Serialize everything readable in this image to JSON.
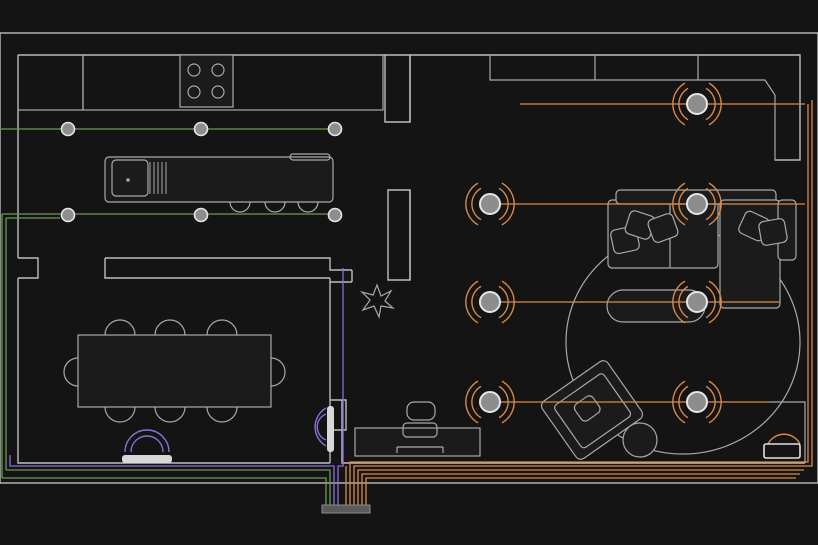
{
  "colors": {
    "background": "#141414",
    "walls": "#bdbdbd",
    "furniture": "#a9a9a9",
    "circuit_green": "#6a9a55",
    "circuit_purple": "#8a6fd6",
    "circuit_orange": "#d98a45",
    "light_ring": "#d98a45",
    "fixture_fill": "#8d8d8d"
  },
  "icons": {
    "hob": "cooktop-icon",
    "sink": "sink-icon",
    "plant": "plant-icon",
    "speaker": "speaker-icon",
    "panel": "distribution-panel-icon"
  },
  "circuits": [
    {
      "id": "kitchen-lighting",
      "color": "circuit_green"
    },
    {
      "id": "speakers",
      "color": "circuit_purple"
    },
    {
      "id": "living-lighting",
      "color": "circuit_orange"
    }
  ]
}
